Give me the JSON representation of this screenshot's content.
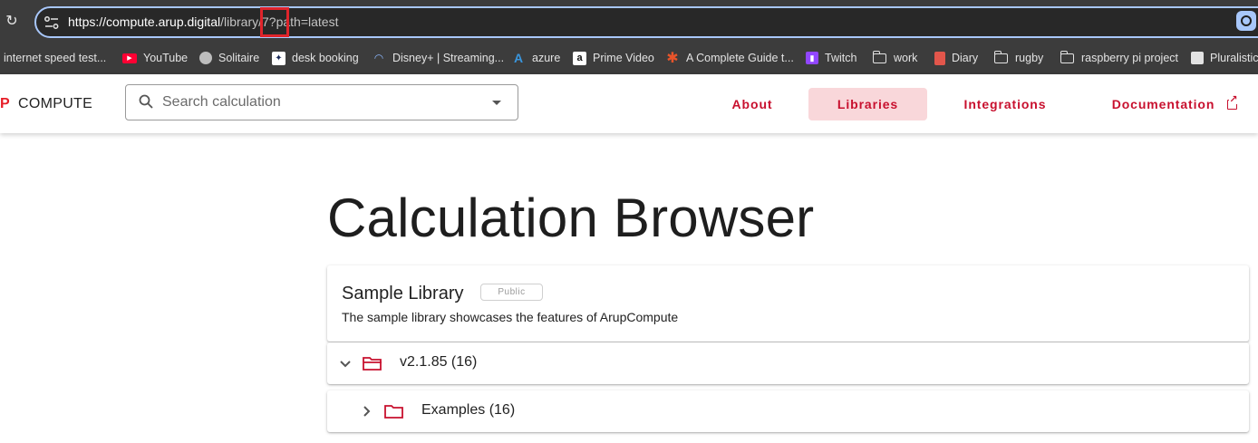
{
  "browser": {
    "url_host": "https://compute.arup.digital",
    "url_path_before": "/library",
    "url_path_highlight": "/7?",
    "url_path_after": "path=latest",
    "bookmarks": [
      {
        "label": "internet speed test...",
        "icon": "none"
      },
      {
        "label": "YouTube",
        "icon": "youtube-icon"
      },
      {
        "label": "Solitaire",
        "icon": "globe-icon"
      },
      {
        "label": "desk booking",
        "icon": "desk-booking-icon"
      },
      {
        "label": "Disney+ | Streaming...",
        "icon": "disney-icon"
      },
      {
        "label": "azure",
        "icon": "azure-icon"
      },
      {
        "label": "Prime Video",
        "icon": "amazon-icon"
      },
      {
        "label": "A Complete Guide t...",
        "icon": "asterisk-icon"
      },
      {
        "label": "Twitch",
        "icon": "twitch-icon"
      },
      {
        "label": "work",
        "icon": "folder-icon"
      },
      {
        "label": "Diary",
        "icon": "diary-icon"
      },
      {
        "label": "rugby",
        "icon": "folder-icon"
      },
      {
        "label": "raspberry pi project",
        "icon": "folder-icon"
      },
      {
        "label": "Pluralistic",
        "icon": "pluralistic-icon"
      }
    ]
  },
  "header": {
    "logo_mark": "P",
    "logo_text": "COMPUTE",
    "search_placeholder": "Search calculation",
    "nav": {
      "about": "About",
      "libraries": "Libraries",
      "integrations": "Integrations",
      "documentation": "Documentation"
    }
  },
  "main": {
    "title": "Calculation Browser",
    "library": {
      "name": "Sample Library",
      "badge": "Public",
      "description": "The sample library showcases the features of ArupCompute"
    },
    "tree": {
      "version": "v2.1.85 (16)",
      "folder": "Examples (16)"
    }
  },
  "colors": {
    "accent": "#c8102e",
    "active_nav_bg": "#f9d7da",
    "highlight_box": "#e0242b"
  }
}
